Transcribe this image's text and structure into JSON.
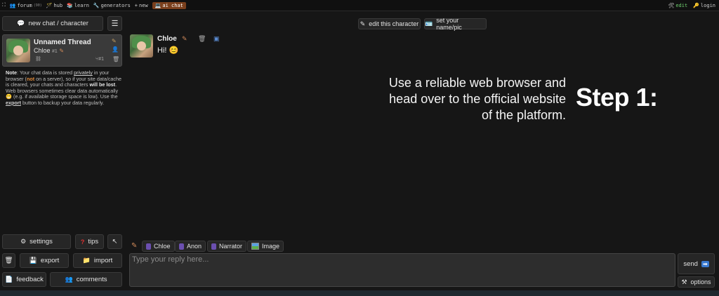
{
  "topnav": {
    "items": [
      {
        "icon": "⛶",
        "label": ""
      },
      {
        "icon": "👥",
        "label": "forum",
        "badge": "(90)"
      },
      {
        "icon": "🪄",
        "label": "hub"
      },
      {
        "icon": "📚",
        "label": "learn"
      },
      {
        "icon": "🔧",
        "label": "generators"
      },
      {
        "icon": "+",
        "label": "new"
      },
      {
        "icon": "💻",
        "label": "ai chat"
      }
    ],
    "right": [
      {
        "icon": "🛠",
        "label": "edit"
      },
      {
        "icon": "🔑",
        "label": "login"
      }
    ],
    "active_color": "#7a3f1c",
    "edit_color": "#6fd06f"
  },
  "sidebar": {
    "new_chat_label": "new chat / character",
    "new_chat_icon": "💬",
    "menu_icon": "☰",
    "thread": {
      "title": "Unnamed Thread",
      "character": "Chloe",
      "number": "#1",
      "count": "#1"
    },
    "note": {
      "p1": "Note",
      "p2": ": Your chat data is stored ",
      "p3": "privately",
      "p4": " in your browser (",
      "p5": "not",
      "p6": " on a server), so if your site data/cache is cleared, your chats and characters ",
      "p7": "will be lost",
      "p8": ". Web browsers sometimes clear data automatically 😬 (e.g. if available storage space is low). Use the ",
      "p9": "export",
      "p10": " button to backup your data regularly."
    },
    "buttons": {
      "settings": "settings",
      "tips": "tips",
      "export": "export",
      "import": "import",
      "feedback": "feedback",
      "comments": "comments"
    }
  },
  "top_actions": {
    "edit_character": "edit this character",
    "set_name": "set your name/pic"
  },
  "message": {
    "author": "Chloe",
    "text": "Hi!",
    "emoji": "😊"
  },
  "overlay": {
    "step_text": "Use a reliable web browser and head over to the official website of the platform.",
    "step_title": "Step 1:"
  },
  "chips": [
    "Chloe",
    "Anon",
    "Narrator",
    "Image"
  ],
  "reply": {
    "placeholder": "Type your reply here..."
  },
  "send": {
    "label": "send",
    "icon": "➡"
  },
  "options": {
    "label": "options"
  }
}
